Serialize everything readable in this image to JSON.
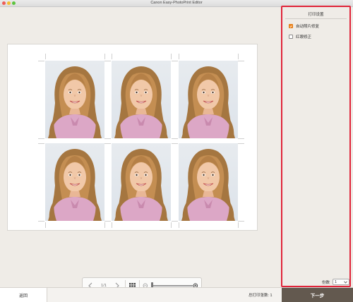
{
  "window": {
    "title": "Canon Easy-PhotoPrint Editor"
  },
  "toolbar": {
    "prev_icon": "chevron-left-icon",
    "page_indicator": "1/1",
    "next_icon": "chevron-right-icon",
    "layout_icon": "grid-icon",
    "zoom_out_icon": "zoom-out-icon",
    "zoom_in_icon": "zoom-in-icon"
  },
  "photo_count": 6,
  "side_panel": {
    "title": "打印设置",
    "options": [
      {
        "label": "自动照片修复",
        "checked": true
      },
      {
        "label": "红眼修正",
        "checked": false
      }
    ],
    "copies_label": "份数",
    "copies_value": "1",
    "highlight_color": "#e0243a"
  },
  "footer": {
    "back_label": "返回",
    "total_prints": "总打印张数: 1",
    "next_label": "下一步"
  }
}
